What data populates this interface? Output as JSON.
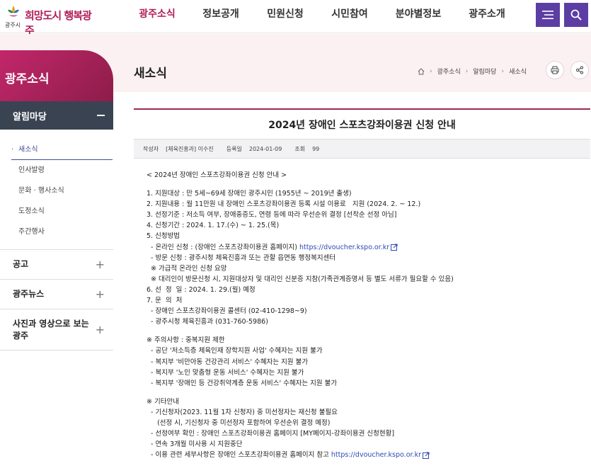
{
  "header": {
    "logo_slogan": "희망도시 행복광주",
    "logo_city": "광주시",
    "gnb": [
      "광주소식",
      "정보공개",
      "민원신청",
      "시민참여",
      "분야별정보",
      "광주소개"
    ],
    "active_gnb": "광주소식"
  },
  "sidebar": {
    "title": "광주소식",
    "group_open": "알림마당",
    "sub_items": [
      "새소식",
      "인사발령",
      "문화 · 행사소식",
      "도정소식",
      "주간행사"
    ],
    "active_sub": "새소식",
    "menus": [
      "공고",
      "광주뉴스",
      "사진과 영상으로 보는 광주"
    ]
  },
  "content": {
    "page_title": "새소식",
    "breadcrumb": [
      "광주소식",
      "알림마당",
      "새소식"
    ]
  },
  "article": {
    "title": "2024년 장애인 스포츠강좌이용권 신청 안내",
    "meta": {
      "author_label": "작성자",
      "author": "[체육진흥과] 이수진",
      "date_label": "등록일",
      "date": "2024-01-09",
      "views_label": "조회",
      "views": "99"
    },
    "lines": [
      {
        "text": "< 2024년 장애인 스포츠강좌이용권 신청 안내 >"
      },
      {
        "text": ""
      },
      {
        "text": "1. 지원대상 : 만 5세~69세 장애인 광주시민 (1955년 ~ 2019년 출생)"
      },
      {
        "text": "2. 지원내용 : 월 11만원 내 장애인 스포츠강좌이용권 등록 시설 이용료   지원 (2024. 2. ~ 12.)"
      },
      {
        "text": "3. 선정기준 : 저소득 여부, 장애중증도, 연령 등에 따라 우선순위 결정 [선착순 선정 아님]"
      },
      {
        "text": "4. 신청기간 : 2024. 1. 17.(수) ~ 1. 25.(목)"
      },
      {
        "text": "5. 신청방법"
      },
      {
        "text": "  - 온라인 신청 : (장애인 스포츠강좌이용권 홈페이지) ",
        "link": "https://dvoucher.kspo.or.kr"
      },
      {
        "text": "  - 방문 신청 : 광주시청 체육진흥과 또는 관할 읍면동 행정복지센터"
      },
      {
        "text": "  ※ 가급적 온라인 신청 요망"
      },
      {
        "text": "  ※ 대리인이 방문신청 시, 지원대상자 및 대리인 신분증 지참(가족관계증명서 등 별도 서류가 필요할 수 있음)"
      },
      {
        "text": "6. 선  정  일 : 2024. 1. 29.(월) 예정"
      },
      {
        "text": "7. 문  의  처"
      },
      {
        "text": "  - 장애인 스포츠강좌이용권 콜센터 (02-410-1298~9)"
      },
      {
        "text": "  - 광주시청 체육진흥과 (031-760-5986)"
      },
      {
        "text": ""
      },
      {
        "text": "※ 주의사항 : 중복지원 제한"
      },
      {
        "text": "  - 공단 '저소득층 체육인재 장학지원 사업' 수혜자는 지원 불가"
      },
      {
        "text": "  - 복지부 '비만아동 건강관리 서비스' 수혜자는 지원 불가"
      },
      {
        "text": "  - 복지부 '노인 맞춤형 운동 서비스' 수혜자는 지원 불가"
      },
      {
        "text": "  - 복지부 '장애인 등 건강취약계층 운동 서비스' 수혜자는 지원 불가"
      },
      {
        "text": ""
      },
      {
        "text": "※ 기타안내"
      },
      {
        "text": "  - 기신청자(2023. 11월 1차 신청자) 중 미선정자는 재신청 불필요"
      },
      {
        "text": "     (선정 시, 기신청자 중 미선정자 포함하여 우선순위 결정 예정)"
      },
      {
        "text": "  - 선정여부 확인 : 장애인 스포츠강좌이용권 홈페이지 [MY페이지-강좌이용권 신청현황]"
      },
      {
        "text": "  - 연속 3개월 미사용 시 지원중단"
      },
      {
        "text": "  - 이용 관련 세부사항은 장애인 스포츠강좌이용권 홈페이지 참고 ",
        "link": "https://dvoucher.kspo.or.kr"
      }
    ]
  },
  "colors": {
    "brand": "#b01d57",
    "purple_button": "#5c3da3",
    "sidebar_dark": "#3a4352",
    "banner_bg": "#fbf0f2",
    "link": "#2b49b5"
  },
  "icons": [
    "hamburger-menu-icon",
    "search-icon",
    "home-icon",
    "print-icon",
    "share-icon",
    "external-link-icon"
  ]
}
